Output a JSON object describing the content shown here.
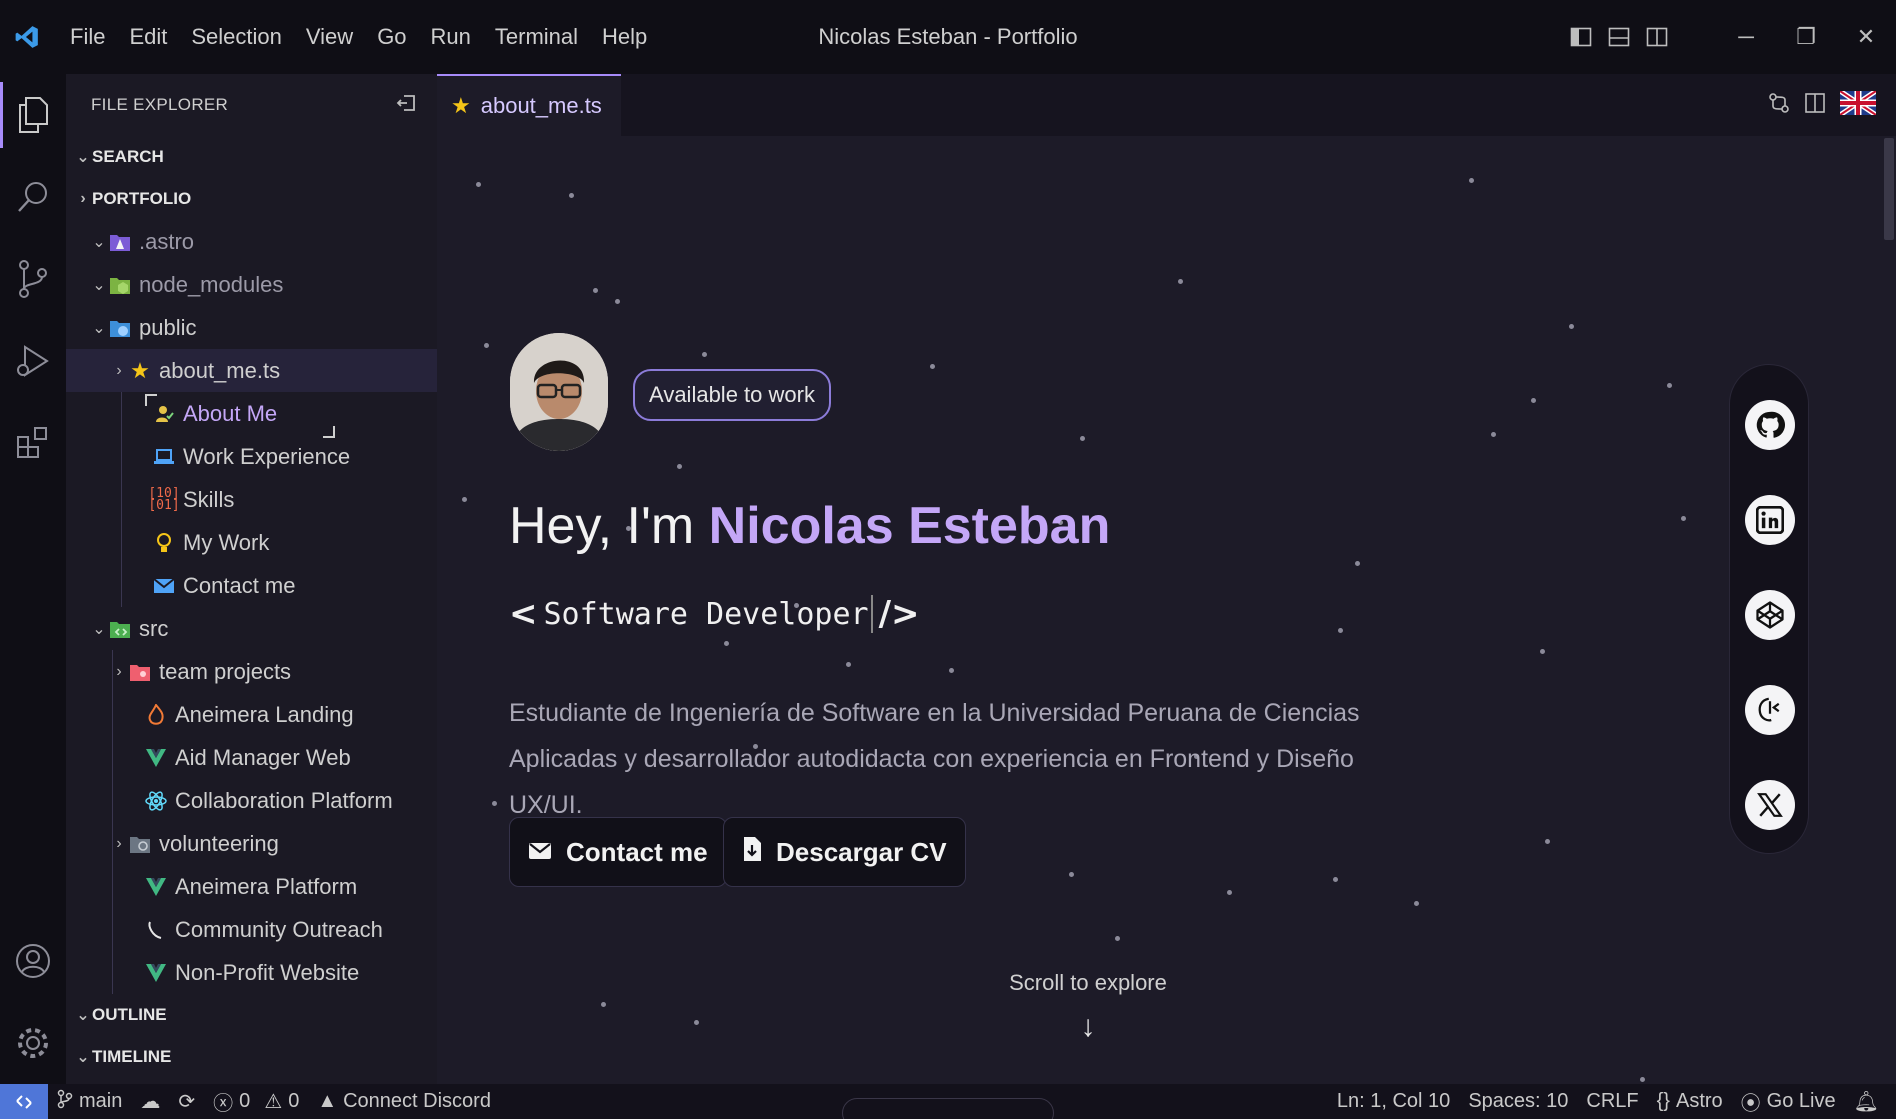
{
  "window": {
    "title": "Nicolas Esteban - Portfolio",
    "menu": [
      "File",
      "Edit",
      "Selection",
      "View",
      "Go",
      "Run",
      "Terminal",
      "Help"
    ]
  },
  "activity_bar": {
    "icons": [
      "files-icon",
      "search-icon",
      "source-control-icon",
      "run-debug-icon",
      "extensions-icon"
    ],
    "bottom_icons": [
      "account-icon",
      "settings-icon"
    ]
  },
  "sidebar": {
    "title": "FILE EXPLORER",
    "sections": {
      "search": "SEARCH",
      "portfolio": "PORTFOLIO",
      "outline": "OUTLINE",
      "timeline": "TIMELINE"
    },
    "folders": {
      "astro": ".astro",
      "node_modules": "node_modules",
      "public": "public",
      "src": "src"
    },
    "about_file": "about_me.ts",
    "about_items": [
      "About Me",
      "Work Experience",
      "Skills",
      "My Work",
      "Contact me"
    ],
    "team_folder": "team projects",
    "team_items": [
      "Aneimera Landing",
      "Aid Manager Web",
      "Collaboration Platform"
    ],
    "volunteer_folder": "volunteering",
    "volunteer_items": [
      "Aneimera Platform",
      "Community Outreach",
      "Non-Profit Website"
    ]
  },
  "editor": {
    "tab_label": "about_me.ts",
    "badge": "Available to work",
    "greeting": "Hey, I'm ",
    "name": "Nicolas Esteban",
    "role_open": "<",
    "role": "Software Developer",
    "role_close": "/>",
    "description": "Estudiante de Ingeniería de Software en la Universidad Peruana de Ciencias Aplicadas y desarrollador autodidacta con experiencia en Frontend y Diseño UX/UI.",
    "contact_button": "Contact me",
    "cv_button": "Descargar CV",
    "scroll_hint": "Scroll to explore",
    "social": [
      "github-icon",
      "linkedin-icon",
      "codepen-icon",
      "codigofacilito-icon",
      "x-icon"
    ]
  },
  "status_bar": {
    "branch": "main",
    "errors": "0",
    "warnings": "0",
    "discord": "Connect Discord",
    "position": "Ln: 1, Col 10",
    "spaces": "Spaces: 10",
    "eol": "CRLF",
    "language": "Astro",
    "go_live": "Go Live"
  },
  "colors": {
    "accent": "#a78bfa",
    "name": "#c4a7f7",
    "remote": "#4f76d8"
  }
}
